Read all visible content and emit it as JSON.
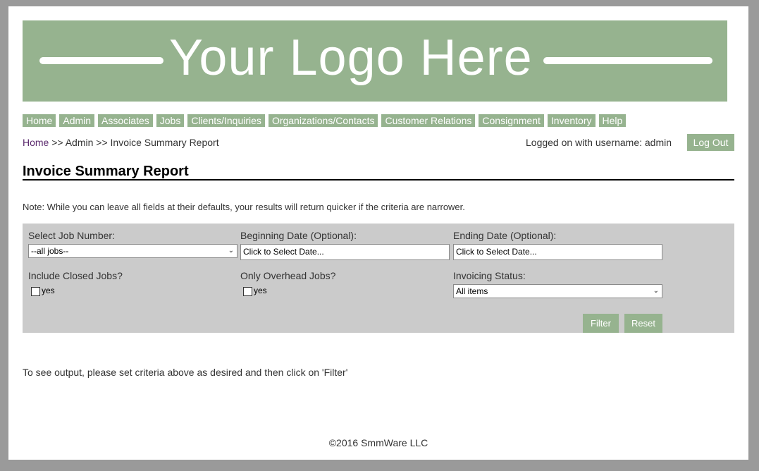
{
  "logo": {
    "text": "Your Logo Here"
  },
  "nav": {
    "items": [
      {
        "label": "Home"
      },
      {
        "label": "Admin"
      },
      {
        "label": "Associates"
      },
      {
        "label": "Jobs"
      },
      {
        "label": "Clients/Inquiries"
      },
      {
        "label": "Organizations/Contacts"
      },
      {
        "label": "Customer Relations"
      },
      {
        "label": "Consignment"
      },
      {
        "label": "Inventory"
      },
      {
        "label": "Help"
      }
    ]
  },
  "breadcrumb": {
    "home": "Home",
    "rest": ">> Admin >> Invoice Summary Report"
  },
  "user": {
    "status": "Logged on with username: admin",
    "logout_label": "Log Out"
  },
  "page": {
    "title": "Invoice Summary Report",
    "note": "Note: While you can leave all fields at their defaults, your results will return quicker if the criteria are narrower."
  },
  "filters": {
    "job_number": {
      "label": "Select Job Number:",
      "value": "--all jobs--"
    },
    "begin_date": {
      "label": "Beginning Date (Optional):",
      "value": "Click to Select Date..."
    },
    "end_date": {
      "label": "Ending Date (Optional):",
      "value": "Click to Select Date..."
    },
    "closed_jobs": {
      "label": "Include Closed Jobs?",
      "option": "yes",
      "checked": false
    },
    "overhead_jobs": {
      "label": "Only Overhead Jobs?",
      "option": "yes",
      "checked": false
    },
    "invoicing_status": {
      "label": "Invoicing Status:",
      "value": "All items"
    },
    "filter_label": "Filter",
    "reset_label": "Reset"
  },
  "output_note": "To see output, please set criteria above as desired and then click on 'Filter'",
  "footer": "©2016 SmmWare LLC",
  "colors": {
    "accent": "#96b38f",
    "panel": "#cbcbcb",
    "frame": "#9a9a9a",
    "link": "#5b2a6e"
  }
}
